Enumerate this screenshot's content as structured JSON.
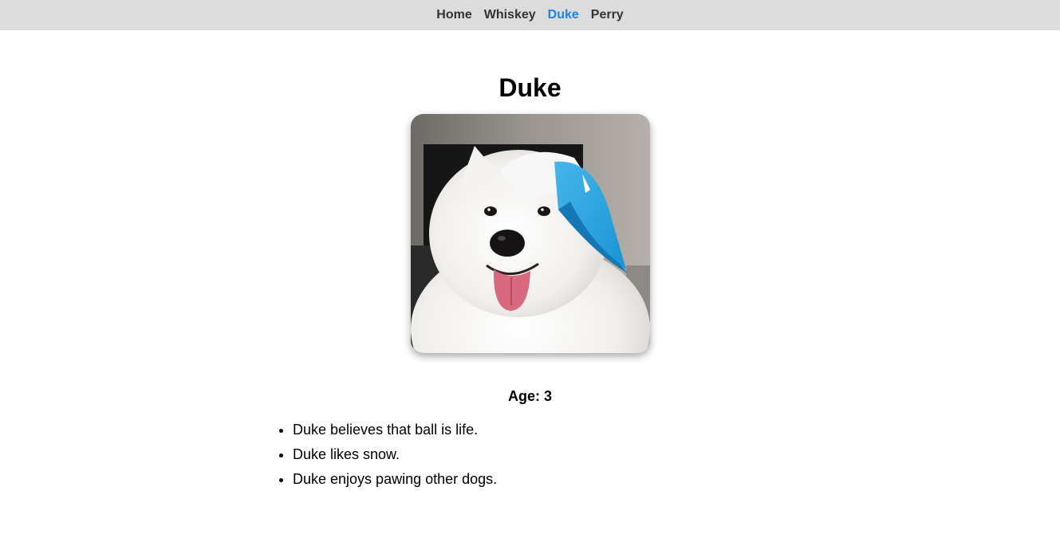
{
  "nav": {
    "links": [
      {
        "label": "Home"
      },
      {
        "label": "Whiskey"
      },
      {
        "label": "Duke"
      },
      {
        "label": "Perry"
      }
    ],
    "active": "Duke",
    "active_color": "#1a84e8",
    "background_color": "#dcdcdc"
  },
  "dog": {
    "name": "Duke",
    "age_text": "Age: 3",
    "facts": [
      "Duke believes that ball is life.",
      "Duke likes snow.",
      "Duke enjoys pawing other dogs."
    ]
  }
}
